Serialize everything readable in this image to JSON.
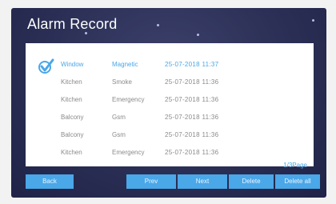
{
  "title": "Alarm Record",
  "records": [
    {
      "location": "Window",
      "type": "Magnetic",
      "time": "25-07-2018  11:37",
      "selected": true
    },
    {
      "location": "Kitchen",
      "type": "Smoke",
      "time": "25-07-2018  11:36",
      "selected": false
    },
    {
      "location": "Kitchen",
      "type": "Emergency",
      "time": "25-07-2018  11:36",
      "selected": false
    },
    {
      "location": "Balcony",
      "type": "Gsm",
      "time": "25-07-2018  11:36",
      "selected": false
    },
    {
      "location": "Balcony",
      "type": "Gsm",
      "time": "25-07-2018  11:36",
      "selected": false
    },
    {
      "location": "Kitchen",
      "type": "Emergency",
      "time": "25-07-2018  11:36",
      "selected": false
    }
  ],
  "page_info": "1/3Page",
  "buttons": {
    "back": "Back",
    "prev": "Prev",
    "next": "Next",
    "delete": "Delete",
    "delete_all": "Delete all"
  },
  "colors": {
    "accent": "#4aa7e8",
    "background": "#2b2f55",
    "panel": "#ffffff",
    "row_text": "#8a8a8a"
  },
  "icons": {
    "selected_marker": "checkmark-icon"
  }
}
